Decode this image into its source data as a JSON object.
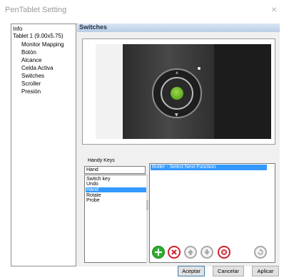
{
  "window": {
    "title": "PenTablet Setting",
    "close_glyph": "×"
  },
  "tree": {
    "items": [
      {
        "label": "Info"
      },
      {
        "label": "Tablet  1 (9.00x5.75)"
      },
      {
        "label": "Monitor Mapping"
      },
      {
        "label": "Botón"
      },
      {
        "label": "Alcance"
      },
      {
        "label": "Celda Activa"
      },
      {
        "label": "Switches"
      },
      {
        "label": "Scroller"
      },
      {
        "label": "Presión"
      }
    ]
  },
  "panel": {
    "title": "Switches"
  },
  "handy_keys": {
    "label": "Handy Keys",
    "current": "Hand",
    "options": [
      "Switch key",
      "Undo",
      "Hand",
      "Rotate",
      "Probe"
    ],
    "selected": "Hand"
  },
  "functions": {
    "items": [
      "Roller - Select Next Function"
    ],
    "selected": "Roller - Select Next Function"
  },
  "toolbar": {
    "buttons": [
      {
        "name": "add",
        "icon": "plus-icon",
        "color": "#2fae2f"
      },
      {
        "name": "delete",
        "icon": "x-icon",
        "color": "#d21f2f"
      },
      {
        "name": "move-up",
        "icon": "arrow-up-icon",
        "color": "#9a9a9a"
      },
      {
        "name": "move-down",
        "icon": "arrow-down-icon",
        "color": "#9a9a9a"
      },
      {
        "name": "delete-all",
        "icon": "delete-all-icon",
        "color": "#d21f2f"
      },
      {
        "name": "reset",
        "icon": "reset-icon",
        "color": "#9a9a9a"
      }
    ]
  },
  "buttons": {
    "ok": "Aceptar",
    "cancel": "Cancelar",
    "apply": "Aplicar"
  },
  "colors": {
    "selection": "#3399ff",
    "header": "#c5d6ea",
    "device_green": "#74bf2c",
    "device_body": "#3a3a3a"
  }
}
